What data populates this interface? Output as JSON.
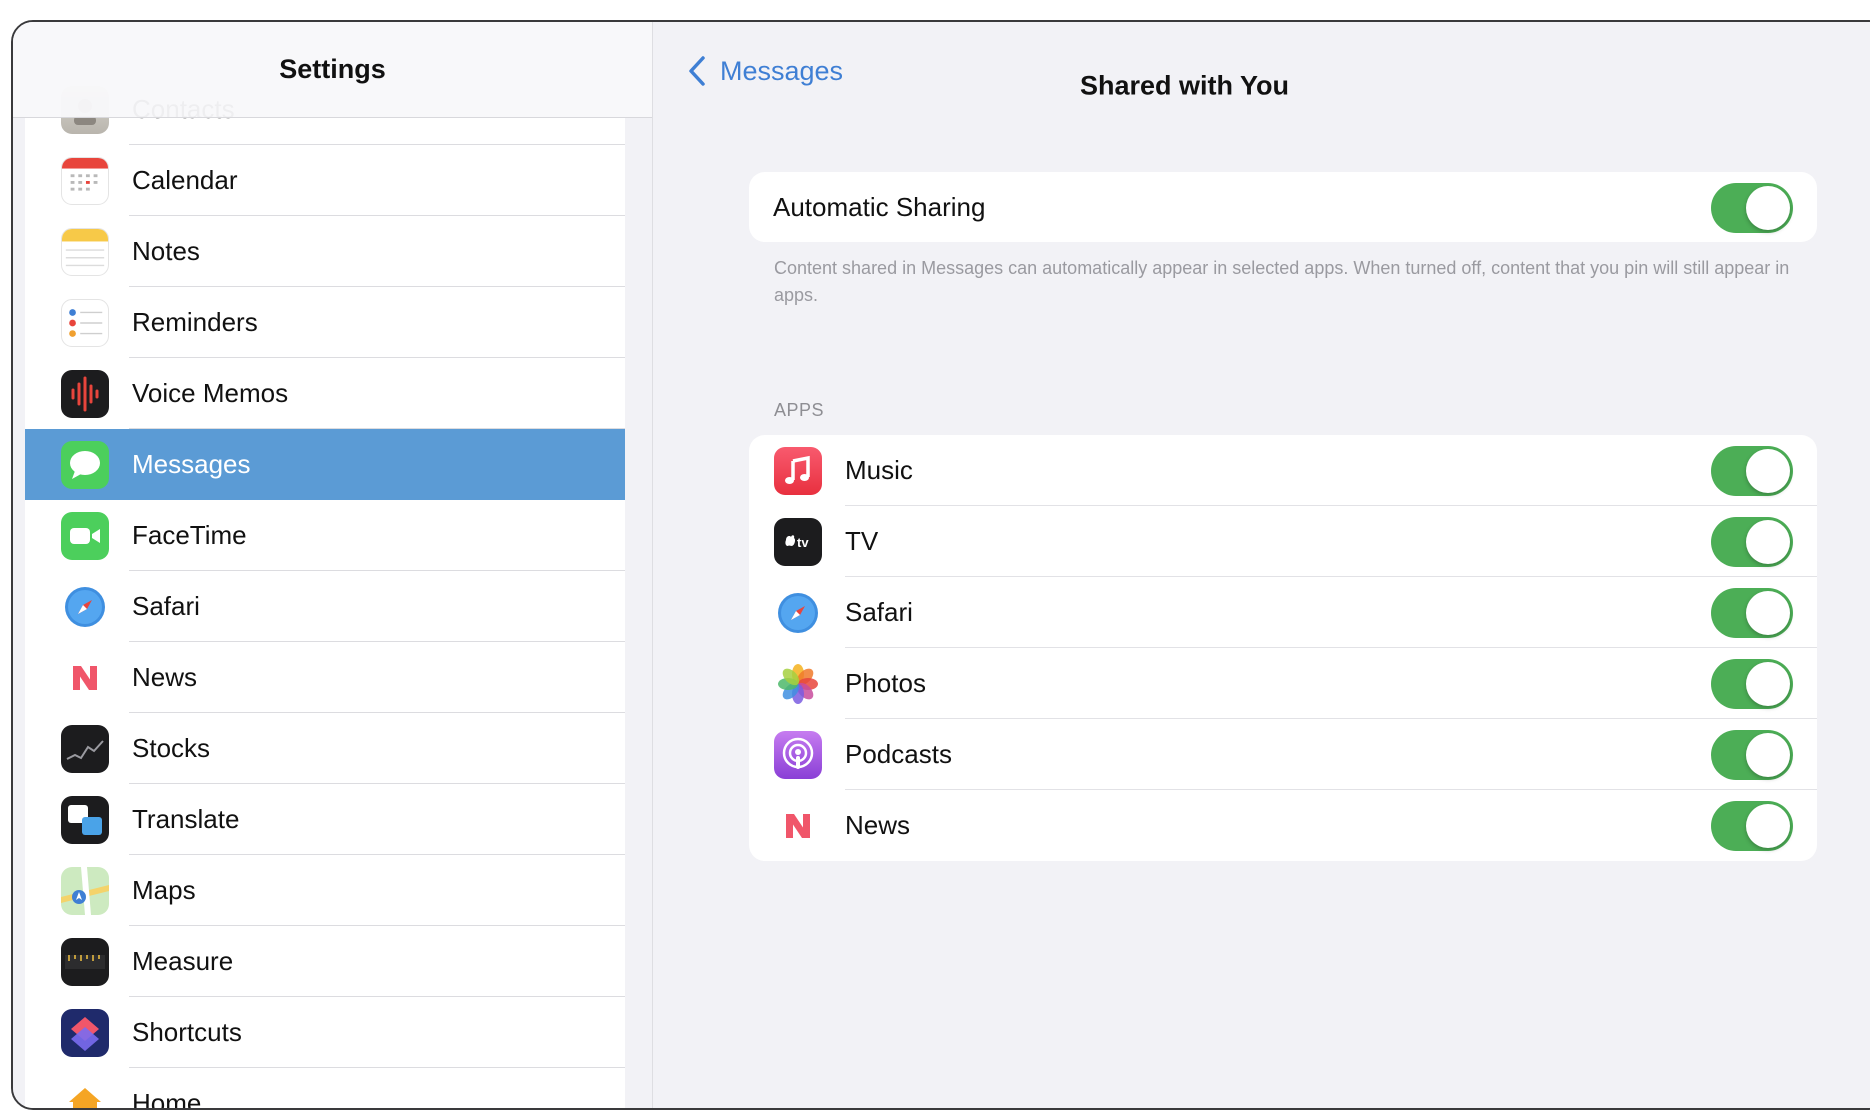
{
  "sidebar": {
    "title": "Settings",
    "items": [
      {
        "label": "Contacts",
        "icon": "contacts-icon"
      },
      {
        "label": "Calendar",
        "icon": "calendar-icon"
      },
      {
        "label": "Notes",
        "icon": "notes-icon"
      },
      {
        "label": "Reminders",
        "icon": "reminders-icon"
      },
      {
        "label": "Voice Memos",
        "icon": "voice-memos-icon"
      },
      {
        "label": "Messages",
        "icon": "messages-icon",
        "selected": true
      },
      {
        "label": "FaceTime",
        "icon": "facetime-icon"
      },
      {
        "label": "Safari",
        "icon": "safari-icon"
      },
      {
        "label": "News",
        "icon": "news-icon"
      },
      {
        "label": "Stocks",
        "icon": "stocks-icon"
      },
      {
        "label": "Translate",
        "icon": "translate-icon"
      },
      {
        "label": "Maps",
        "icon": "maps-icon"
      },
      {
        "label": "Measure",
        "icon": "measure-icon"
      },
      {
        "label": "Shortcuts",
        "icon": "shortcuts-icon"
      },
      {
        "label": "Home",
        "icon": "home-icon"
      }
    ],
    "selected_color": "#5b9bd5"
  },
  "detail": {
    "back_label": "Messages",
    "title": "Shared with You",
    "automatic_sharing": {
      "label": "Automatic Sharing",
      "enabled": true
    },
    "footnote": "Content shared in Messages can automatically appear in selected apps. When turned off, content that you pin will still appear in apps.",
    "apps_header": "APPS",
    "apps": [
      {
        "label": "Music",
        "icon": "music-icon",
        "enabled": true
      },
      {
        "label": "TV",
        "icon": "tv-icon",
        "enabled": true
      },
      {
        "label": "Safari",
        "icon": "safari-icon",
        "enabled": true
      },
      {
        "label": "Photos",
        "icon": "photos-icon",
        "enabled": true
      },
      {
        "label": "Podcasts",
        "icon": "podcasts-icon",
        "enabled": true
      },
      {
        "label": "News",
        "icon": "news-icon",
        "enabled": true
      }
    ]
  },
  "colors": {
    "accent": "#3f7fd4",
    "toggle_on": "#4cae56",
    "background": "#f2f2f6"
  }
}
